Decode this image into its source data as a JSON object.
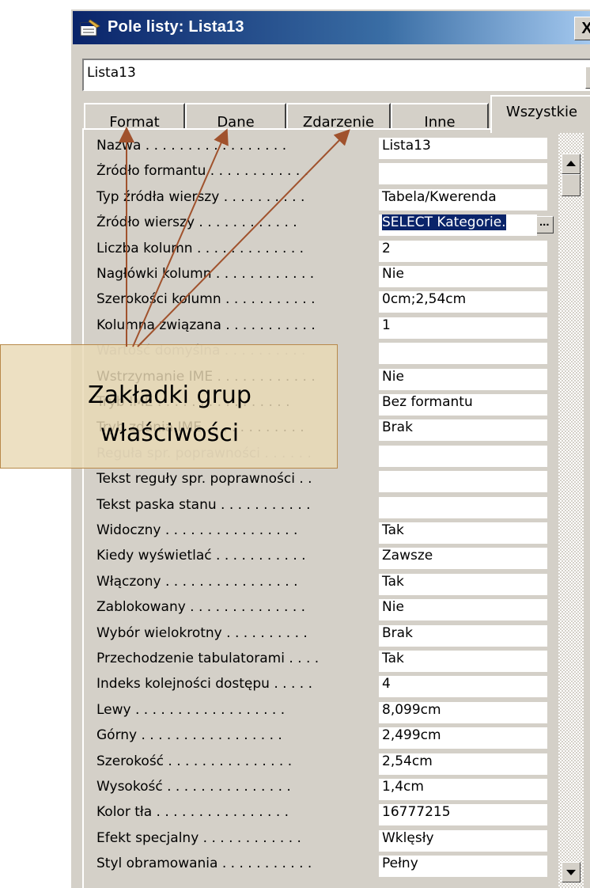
{
  "window": {
    "title": "Pole listy: Lista13",
    "close_label": "X"
  },
  "object_selector": {
    "value": "Lista13"
  },
  "tabs": [
    {
      "label": "Format",
      "active": false
    },
    {
      "label": "Dane",
      "active": false
    },
    {
      "label": "Zdarzenie",
      "active": false
    },
    {
      "label": "Inne",
      "active": false
    },
    {
      "label": "Wszystkie",
      "active": true
    }
  ],
  "properties": [
    {
      "name": "Nazwa . . . . . . . . . . . . . . . . .",
      "value": "Lista13"
    },
    {
      "name": "Źródło formantu . . . . . . . . . . . .",
      "value": ""
    },
    {
      "name": "Typ źródła wierszy . . . . . . . . . .",
      "value": "Tabela/Kwerenda"
    },
    {
      "name": "Źródło wierszy . . . . . . . . . . . .",
      "value": "SELECT Kategorie."
    },
    {
      "name": "Liczba kolumn . . . . . . . . . . . . .",
      "value": "2"
    },
    {
      "name": "Nagłówki kolumn . . . . . . . . . . . .",
      "value": "Nie"
    },
    {
      "name": "Szerokości kolumn . . . . . . . . . . .",
      "value": "0cm;2,54cm"
    },
    {
      "name": "Kolumna związana . . . . . . . . . . .",
      "value": "1"
    },
    {
      "name": "Wartość domyślna . . . . . . . . . .",
      "value": ""
    },
    {
      "name": "Wstrzymanie IME . . . . . . . . . . . .",
      "value": "Nie"
    },
    {
      "name": "Tryb IME . . . . . . . . . . . . . . . .",
      "value": "Bez formantu"
    },
    {
      "name": "Tryb zdania IME . . . . . . . . . . . .",
      "value": "Brak"
    },
    {
      "name": "Reguła spr. poprawności . . . . . .",
      "value": ""
    },
    {
      "name": "Tekst reguły spr. poprawności . .",
      "value": ""
    },
    {
      "name": "Tekst paska stanu . . . . . . . . . . .",
      "value": ""
    },
    {
      "name": "Widoczny . . . . . . . . . . . . . . . .",
      "value": "Tak"
    },
    {
      "name": "Kiedy wyświetlać . . . . . . . . . . .",
      "value": "Zawsze"
    },
    {
      "name": "Włączony . . . . . . . . . . . . . . . .",
      "value": "Tak"
    },
    {
      "name": "Zablokowany . . . . . . . . . . . . . .",
      "value": "Nie"
    },
    {
      "name": "Wybór wielokrotny . . . . . . . . . .",
      "value": "Brak"
    },
    {
      "name": "Przechodzenie tabulatorami . . . .",
      "value": "Tak"
    },
    {
      "name": "Indeks kolejności dostępu . . . . .",
      "value": "4"
    },
    {
      "name": "Lewy . . . . . . . . . . . . . . . . . .",
      "value": "8,099cm"
    },
    {
      "name": "Górny . . . . . . . . . . . . . . . . .",
      "value": "2,499cm"
    },
    {
      "name": "Szerokość . . . . . . . . . . . . . . .",
      "value": "2,54cm"
    },
    {
      "name": "Wysokość . . . . . . . . . . . . . . .",
      "value": "1,4cm"
    },
    {
      "name": "Kolor tła . . . . . . . . . . . . . . . .",
      "value": "16777215"
    },
    {
      "name": "Efekt specjalny . . . . . . . . . . . .",
      "value": "Wklęsły"
    },
    {
      "name": "Styl obramowania . . . . . . . . . . .",
      "value": "Pełny"
    }
  ],
  "callout": {
    "line1": "Zakładki grup",
    "line2": "właściwości",
    "border_color": "#b8894a",
    "arrow_color": "#b8894a"
  },
  "colors": {
    "title_bar": "#0a246a",
    "face": "#d4d0c8",
    "selection": "#0a246a"
  }
}
